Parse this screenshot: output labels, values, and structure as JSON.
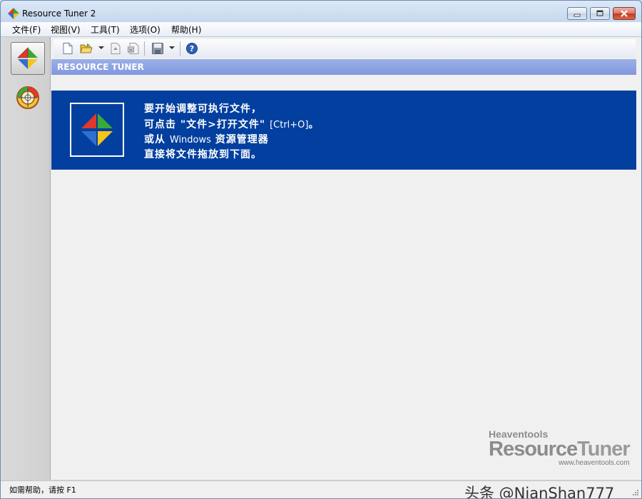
{
  "window": {
    "title": "Resource Tuner 2"
  },
  "menu": {
    "items": [
      "文件(F)",
      "视图(V)",
      "工具(T)",
      "选项(O)",
      "帮助(H)"
    ]
  },
  "icons": {
    "new": "new-file-icon",
    "open": "open-folder-icon",
    "open_dropdown": "chevron-down-icon",
    "export": "export-icon",
    "import": "import-icon",
    "save": "save-disk-icon",
    "save_dropdown": "chevron-down-icon",
    "help": "help-icon"
  },
  "section": {
    "title": "RESOURCE TUNER"
  },
  "banner": {
    "line1": "要开始调整可执行文件，",
    "line2_prefix": "可点击 \"文件>打开文件\" ",
    "line2_shortcut": "[Ctrl+O]",
    "line2_suffix": "。",
    "line3_prefix": "或从 ",
    "line3_app": "Windows",
    "line3_suffix": " 资源管理器",
    "line4": "直接将文件拖放到下面。"
  },
  "watermark": {
    "company": "Heaventools",
    "product_part1": "Resource",
    "product_part2": "Tuner",
    "url": "www.heaventools.com"
  },
  "status": {
    "text": "如需帮助，请按 F1"
  },
  "overlay": {
    "text": "头条 @NianShan777"
  },
  "colors": {
    "banner_bg": "#023f9f",
    "header_bg": "#8a9fe2",
    "logo_red": "#e0382a",
    "logo_green": "#39a83a",
    "logo_blue": "#2f6fd0",
    "logo_yellow": "#f5c518"
  }
}
